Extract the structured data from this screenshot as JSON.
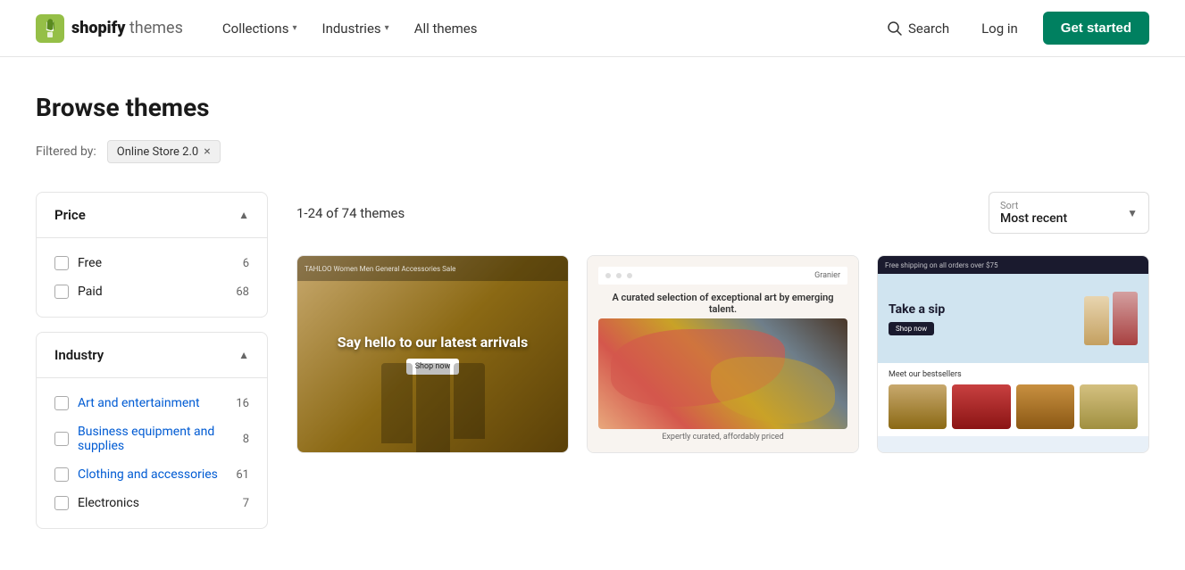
{
  "header": {
    "logo_brand": "shopify",
    "logo_suffix": " themes",
    "nav": [
      {
        "label": "Collections",
        "has_dropdown": true
      },
      {
        "label": "Industries",
        "has_dropdown": true
      },
      {
        "label": "All themes",
        "has_dropdown": false
      }
    ],
    "search_label": "Search",
    "login_label": "Log in",
    "cta_label": "Get started"
  },
  "page": {
    "title": "Browse themes",
    "filter_label": "Filtered by:",
    "active_filter": "Online Store 2.0",
    "active_filter_x": "×"
  },
  "sort": {
    "label": "Sort",
    "value": "Most recent",
    "chevron": "▼"
  },
  "themes_count": "1-24 of 74 themes",
  "sidebar": {
    "price_section": {
      "label": "Price",
      "chevron": "▲",
      "items": [
        {
          "label": "Free",
          "count": "6"
        },
        {
          "label": "Paid",
          "count": "68"
        }
      ]
    },
    "industry_section": {
      "label": "Industry",
      "chevron": "▲",
      "items": [
        {
          "label": "Art and entertainment",
          "count": "16",
          "colored": true
        },
        {
          "label": "Business equipment and supplies",
          "count": "8",
          "colored": true
        },
        {
          "label": "Clothing and accessories",
          "count": "61",
          "colored": true
        },
        {
          "label": "Electronics",
          "count": "7",
          "colored": false
        }
      ]
    }
  },
  "themes": [
    {
      "id": 1,
      "nav_text": "TAHLOO  Women  Men  General  Accessories  Sale",
      "hero_text": "Say hello to our latest arrivals",
      "has_figures": true
    },
    {
      "id": 2,
      "brand": "Granier",
      "title": "A curated selection of exceptional art by emerging talent.",
      "caption": "Expertly curated, affordably priced"
    },
    {
      "id": 3,
      "top_text": "Free shipping on all orders over $75",
      "hero_text": "Take a sip",
      "cta": "Shop now",
      "section_title": "Meet our bestsellers"
    }
  ]
}
